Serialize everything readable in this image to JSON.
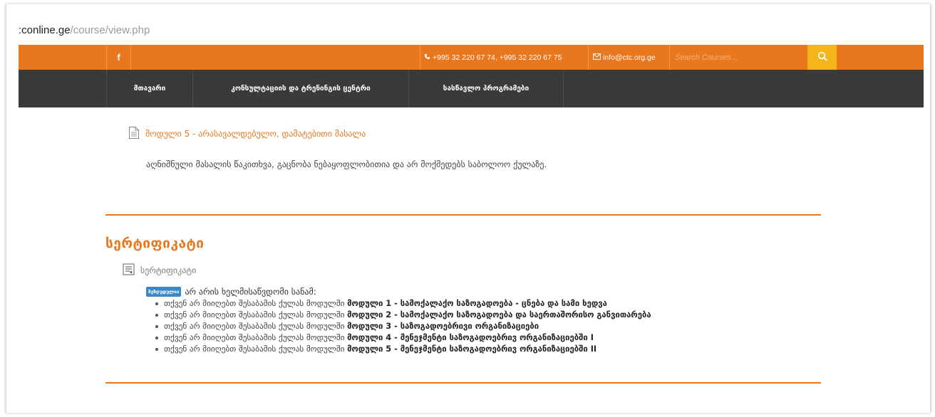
{
  "url": {
    "domain": ":conline.ge",
    "path": "/course/view.php"
  },
  "topbar": {
    "facebook": "f",
    "phone": "+995 32 220 67 74, +995 32 220 67 75",
    "email": "info@ctc.org.ge",
    "search_placeholder": "Search Courses..."
  },
  "nav": {
    "items": [
      {
        "label": "მთავარი"
      },
      {
        "label": "კონსულტაციის და ტრენინგის ცენტრი"
      },
      {
        "label": "სასწავლო პროგრამები"
      }
    ]
  },
  "module": {
    "link_label": "მოდული 5 - არასავალდებულო, დამატებითი მასალა",
    "description": "აღნიშნული მასალის წაკითხვა, გაცნობა ნებაყოფლობითია და არ მოქმედებს საბოლოო ქულაზე."
  },
  "certificate": {
    "section_title": "სერტიფიკატი",
    "link_label": "სერტიფიკატი",
    "badge": "შეზღუდულია",
    "restriction_text": "არ არის ხელმისაწვდომი სანამ:",
    "requirements": [
      {
        "prefix": "თქვენ არ მიიღებთ შესაბამის ქულას მოდულში",
        "module": "მოდული 1 - სამოქალაქო საზოგადოება - ცნება და სამი ხედვა"
      },
      {
        "prefix": "თქვენ არ მიიღებთ შესაბამის ქულას მოდულში",
        "module": "მოდული 2 - სამოქალაქო საზოგადოება და საერთაშორისო განვითარება"
      },
      {
        "prefix": "თქვენ არ მიიღებთ შესაბამის ქულას მოდულში",
        "module": "მოდული 3 - საზოგადოებრივი ორგანიზაციები"
      },
      {
        "prefix": "თქვენ არ მიიღებთ შესაბამის ქულას მოდულში",
        "module": "მოდული 4 - მენეჯმენტი საზოგადოებრივ ორგანიზაციებში I"
      },
      {
        "prefix": "თქვენ არ მიიღებთ შესაბამის ქულას მოდულში",
        "module": "მოდული 5 - მენეჯმენტი საზოგადოებრივ ორგანიზაციებში II"
      }
    ]
  },
  "colors": {
    "accent": "#e8771e",
    "nav_bg": "#3a3a3a",
    "search_button": "#f5b41a",
    "badge": "#3a87c8"
  },
  "icons": {
    "facebook": "facebook-icon",
    "phone": "phone-icon",
    "email": "envelope-icon",
    "search": "search-icon",
    "file": "file-icon",
    "certificate": "certificate-icon"
  }
}
